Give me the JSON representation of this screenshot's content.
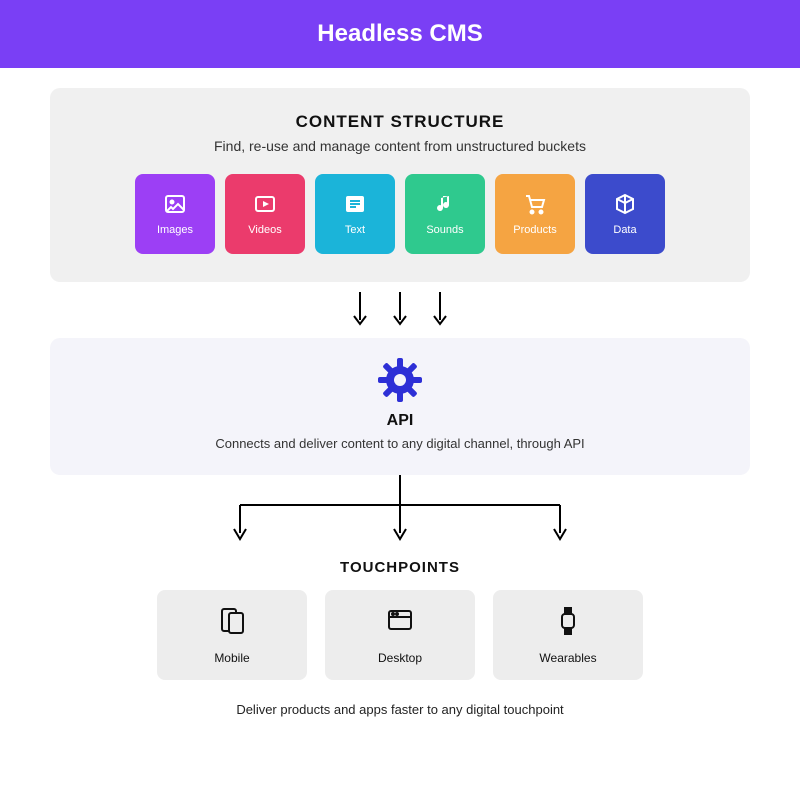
{
  "banner": {
    "title": "Headless CMS"
  },
  "content": {
    "heading": "CONTENT STRUCTURE",
    "subtitle": "Find, re-use  and manage content from unstructured buckets",
    "tiles": [
      {
        "label": "Images",
        "icon": "image-icon"
      },
      {
        "label": "Videos",
        "icon": "video-icon"
      },
      {
        "label": "Text",
        "icon": "text-icon"
      },
      {
        "label": "Sounds",
        "icon": "sound-icon"
      },
      {
        "label": "Products",
        "icon": "product-icon"
      },
      {
        "label": "Data",
        "icon": "data-icon"
      }
    ]
  },
  "api": {
    "title": "API",
    "subtitle": "Connects and deliver content to any digital channel, through API"
  },
  "touchpoints": {
    "heading": "TOUCHPOINTS",
    "items": [
      {
        "label": "Mobile",
        "icon": "mobile-icon"
      },
      {
        "label": "Desktop",
        "icon": "desktop-icon"
      },
      {
        "label": "Wearables",
        "icon": "wearable-icon"
      }
    ],
    "footer": "Deliver products and apps faster to any digital touchpoint"
  },
  "colors": {
    "banner": "#7A3FF5",
    "gear": "#2D2FD6",
    "tiles": {
      "images": "#9C3FF5",
      "videos": "#EB3B6C",
      "text": "#1BB4D9",
      "sounds": "#2FC98E",
      "products": "#F5A442",
      "data": "#3C4BCC"
    }
  }
}
